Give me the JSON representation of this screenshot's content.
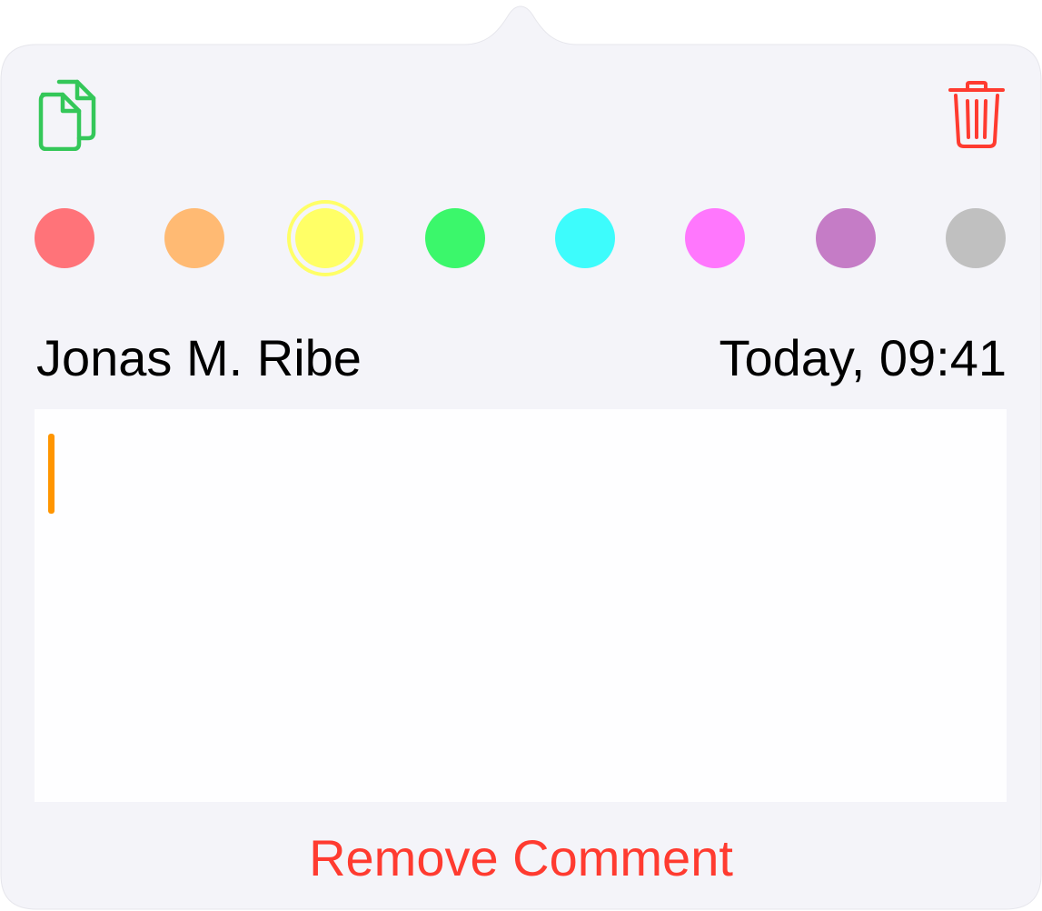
{
  "popover": {
    "background": "#f4f4f9"
  },
  "toolbar": {
    "copy_icon": "copy-documents-icon",
    "copy_color": "#34c759",
    "trash_icon": "trash-icon",
    "trash_color": "#ff3b30"
  },
  "colors": {
    "options": [
      {
        "name": "red",
        "hex": "#ff7379"
      },
      {
        "name": "orange",
        "hex": "#ffba73"
      },
      {
        "name": "yellow",
        "hex": "#ffff66",
        "selected": true
      },
      {
        "name": "green",
        "hex": "#3bf76b"
      },
      {
        "name": "cyan",
        "hex": "#3dfcfc"
      },
      {
        "name": "pink",
        "hex": "#ff77fd"
      },
      {
        "name": "purple",
        "hex": "#c57cc6"
      },
      {
        "name": "gray",
        "hex": "#c0c0c0"
      }
    ]
  },
  "comment": {
    "author": "Jonas M. Ribe",
    "timestamp": "Today, 09:41",
    "text": "",
    "caret_color": "#ff9500"
  },
  "actions": {
    "remove_label": "Remove Comment",
    "remove_color": "#ff3b30"
  }
}
